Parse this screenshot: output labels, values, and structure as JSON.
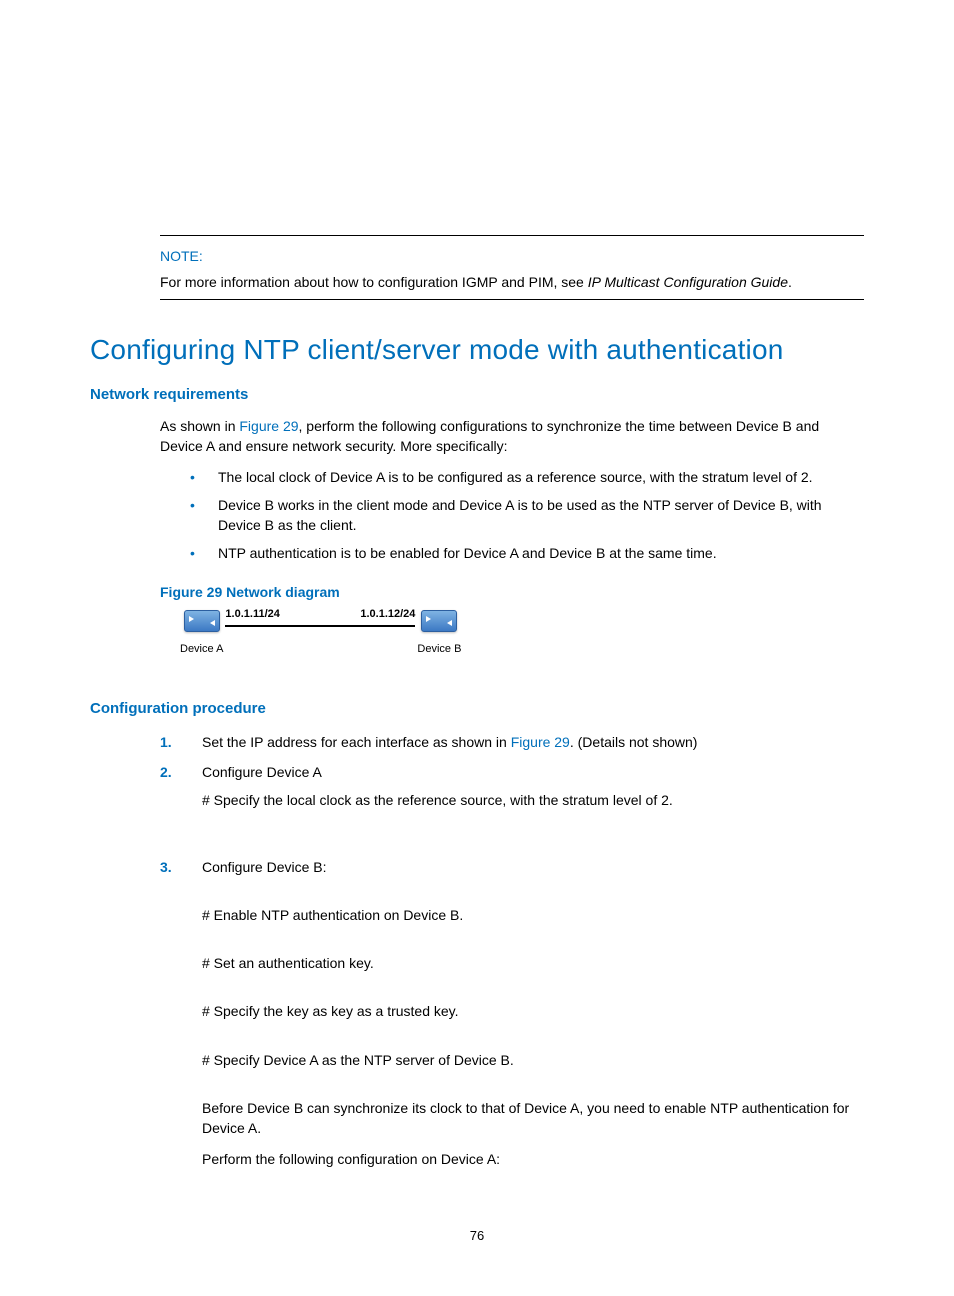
{
  "note": {
    "label": "NOTE:",
    "text_prefix": "For more information about how to configuration IGMP and PIM, see ",
    "text_italic": "IP Multicast Configuration Guide",
    "text_suffix": "."
  },
  "title": "Configuring NTP client/server mode with authentication",
  "network_requirements": {
    "heading": "Network requirements",
    "intro_prefix": "As shown in ",
    "intro_link": "Figure 29",
    "intro_suffix": ", perform the following configurations to synchronize the time between Device B and Device A and ensure network security. More specifically:",
    "bullets": [
      "The local clock of Device A is to be configured as a reference source, with the stratum level of 2.",
      "Device B works in the client mode and Device A is to be used as the NTP server of Device B, with Device B as the client.",
      "NTP authentication is to be enabled for Device A and Device B at the same time."
    ]
  },
  "figure": {
    "caption": "Figure 29 Network diagram",
    "device_a": {
      "label": "Device A",
      "ip": "1.0.1.11/24"
    },
    "device_b": {
      "label": "Device B",
      "ip": "1.0.1.12/24"
    }
  },
  "configuration_procedure": {
    "heading": "Configuration procedure",
    "steps": [
      {
        "n": "1.",
        "text_prefix": "Set the IP address for each interface as shown in ",
        "text_link": "Figure 29",
        "text_suffix": ". (Details not shown)"
      },
      {
        "n": "2.",
        "text": "Configure Device A",
        "sub": "# Specify the local clock as the reference source, with the stratum level of 2."
      },
      {
        "n": "3.",
        "text": "Configure Device B:",
        "blocks": [
          "# Enable NTP authentication on Device B.",
          "# Set an authentication key.",
          "# Specify the key as key as a trusted key.",
          "# Specify Device A as the NTP server of Device B."
        ],
        "followup1": "Before Device B can synchronize its clock to that of Device A, you need to enable NTP authentication for Device A.",
        "followup2": "Perform the following configuration on Device A:"
      }
    ]
  },
  "page_number": "76"
}
